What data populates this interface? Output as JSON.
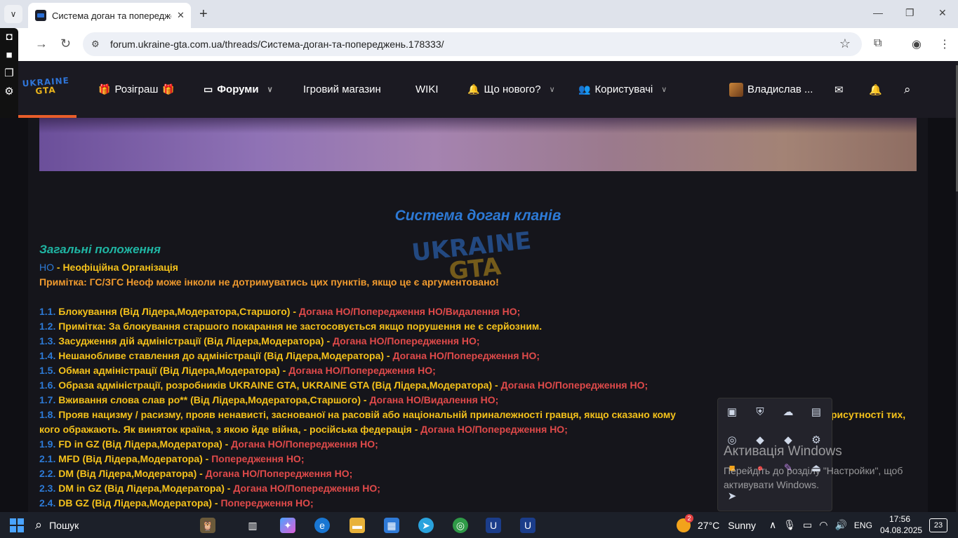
{
  "browser": {
    "tab_title": "Система доган та попереджень",
    "url": "forum.ukraine-gta.com.ua/threads/Система-доган-та-попереджень.178333/"
  },
  "site": {
    "logo_line1": "UKRAINE",
    "logo_line2": "GTA",
    "nav": {
      "giveaway": "Розіграш",
      "forums": "Форуми",
      "shop": "Ігровий магазин",
      "wiki": "WIKI",
      "whats_new": "Що нового?",
      "users": "Користувачі",
      "username": "Владислав ..."
    }
  },
  "content": {
    "heading": "Система доган кланів",
    "subheading": "Загальні положення",
    "intro": [
      {
        "a": "НО",
        "b": " - Неофіційна Організація"
      },
      {
        "a": "Примітка: ГС/ЗГС Неоф може інколи не дотримуватись цих пунктів, якщо це є аргументовано!"
      }
    ],
    "rules": [
      {
        "num": "1.1.",
        "text": " Блокування (Від Лідера,Модератора,Старшого) - ",
        "penalty": "Догана НО/Попередження НО/Видалення НО;"
      },
      {
        "num": "1.2.",
        "text": " Примітка: За блокування старшого покарання не застосовується якщо порушення не є серйозним.",
        "penalty": ""
      },
      {
        "num": "1.3.",
        "text": " Засудження дій адміністрації (Від Лідера,Модератора) - ",
        "penalty": "Догана НО/Попередження НО;"
      },
      {
        "num": "1.4.",
        "text": " Нешанобливе ставлення до адміністрації (Від Лідера,Модератора) - ",
        "penalty": "Догана НО/Попередження НО;"
      },
      {
        "num": "1.5.",
        "text": " Обман адміністрації (Від Лідера,Модератора) - ",
        "penalty": "Догана НО/Попередження НО;"
      },
      {
        "num": "1.6.",
        "text": " Образа адміністрації, розробників UKRAINE GTA, UKRAINE GTA (Від Лідера,Модератора) - ",
        "penalty": "Догана НО/Попередження НО;"
      },
      {
        "num": "1.7.",
        "text": " Вживання слова слав ро** (Від Лідера,Модератора,Старшого) - ",
        "penalty": "Догана НО/Видалення НО;"
      },
      {
        "num": "1.8.",
        "text": " Прояв нацизму / расизму, прояв ненависті, заснованої на расовій або національній приналежності гравця, якщо сказано кому",
        "penalty": ""
      },
      {
        "num": "",
        "text": "кого ображають. Як виняток країна, з якою йде війна, - російська федерація - ",
        "penalty": "Догана НО/Попередження НО;"
      },
      {
        "num": "1.9.",
        "text": " FD in GZ (Від Лідера,Модератора) - ",
        "penalty": "Догана НО/Попередження НО;"
      },
      {
        "num": "2.1.",
        "text": " MFD (Від Лідера,Модератора) - ",
        "penalty": "Попередження НО;"
      },
      {
        "num": "2.2.",
        "text": " DM (Від Лідера,Модератора) - ",
        "penalty": "Догана НО/Попередження НО;"
      },
      {
        "num": "2.3.",
        "text": " DM in GZ (Від Лідера,Модератора) - ",
        "penalty": "Догана НО/Попередження НО;"
      },
      {
        "num": "2.4.",
        "text": " DB GZ (Від Лідера,Модератора) - ",
        "penalty": "Попередження НО;"
      }
    ],
    "rule18_tail": "рисутності тих,"
  },
  "overlay": {
    "activation_title": "Активація Windows",
    "activation_text_1": "Перейдіть до розділу \"Настройки\", щоб",
    "activation_text_2": "активувати Windows."
  },
  "taskbar": {
    "search": "Пошук",
    "weather_badge": "2",
    "temp": "27°C",
    "condition": "Sunny",
    "lang": "ENG",
    "time": "17:56",
    "date": "04.08.2025",
    "notifications": "23"
  },
  "colors": {
    "number_blue": "#2d7ad6",
    "rule_yellow": "#f5c21b",
    "note_orange": "#f09a2e",
    "penalty_red": "#e04a4a",
    "subheading_teal": "#1fb5a3"
  }
}
